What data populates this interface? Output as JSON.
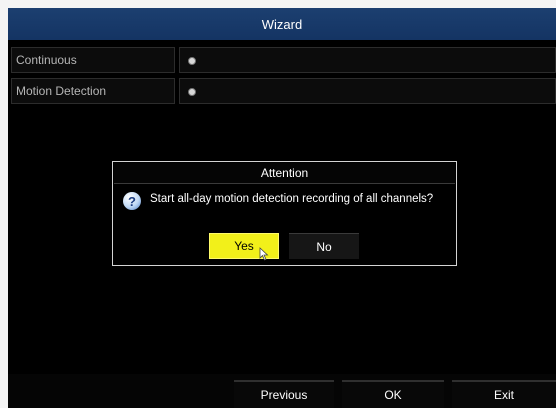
{
  "window": {
    "title": "Wizard"
  },
  "options": [
    {
      "label": "Continuous"
    },
    {
      "label": "Motion Detection"
    }
  ],
  "dialog": {
    "title": "Attention",
    "message": "Start all-day motion detection recording of all channels?",
    "yes_label": "Yes",
    "no_label": "No",
    "icon": "question-icon"
  },
  "footer": {
    "previous_label": "Previous",
    "ok_label": "OK",
    "exit_label": "Exit"
  },
  "colors": {
    "titlebar": "#143463",
    "highlight_button": "#f2f01a"
  }
}
